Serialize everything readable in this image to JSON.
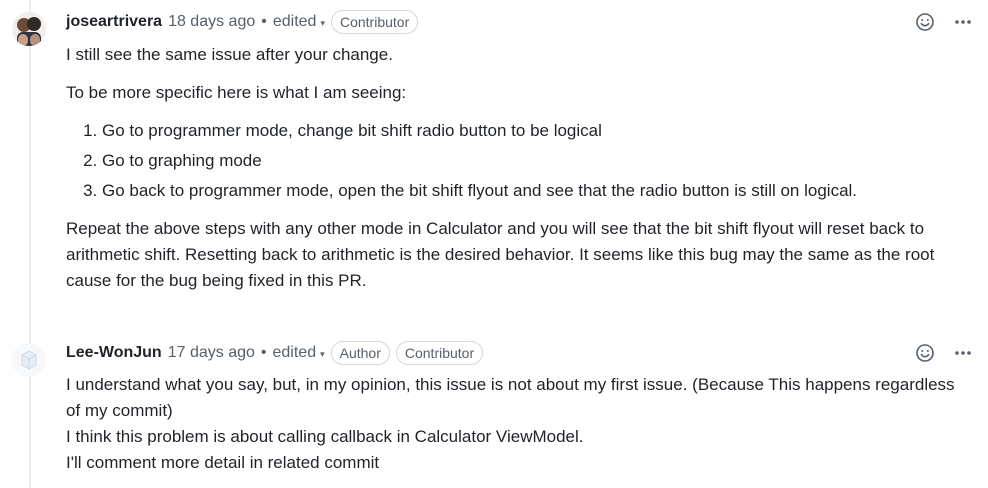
{
  "comments": [
    {
      "author": "joseartrivera",
      "time": "18 days ago",
      "separator": "•",
      "edited_label": "edited",
      "badges": [
        "Contributor"
      ],
      "icons": {
        "reaction": "smiley-icon",
        "more": "kebab-horizontal-icon"
      },
      "body": {
        "p1": "I still see the same issue after your change.",
        "p2": "To be more specific here is what I am seeing:",
        "list": [
          "Go to programmer mode, change bit shift radio button to be logical",
          "Go to graphing mode",
          "Go back to programmer mode, open the bit shift flyout and see that the radio button is still on logical."
        ],
        "p3": "Repeat the above steps with any other mode in Calculator and you will see that the bit shift flyout will reset back to arithmetic shift. Resetting back to arithmetic is the desired behavior. It seems like this bug may the same as the root cause for the bug being fixed in this PR."
      }
    },
    {
      "author": "Lee-WonJun",
      "time": "17 days ago",
      "separator": "•",
      "edited_label": "edited",
      "badges": [
        "Author",
        "Contributor"
      ],
      "icons": {
        "reaction": "smiley-icon",
        "more": "kebab-horizontal-icon"
      },
      "body": {
        "line1": "I understand what you say, but, in my opinion, this issue is not about my first issue. (Because This happens regardless of my commit)",
        "line2": "I think this problem is about calling callback in Calculator ViewModel.",
        "line3": "I'll comment more detail in related commit"
      }
    }
  ],
  "colors": {
    "text": "#1f2328",
    "muted": "#57606a",
    "border": "#d0d7de"
  }
}
